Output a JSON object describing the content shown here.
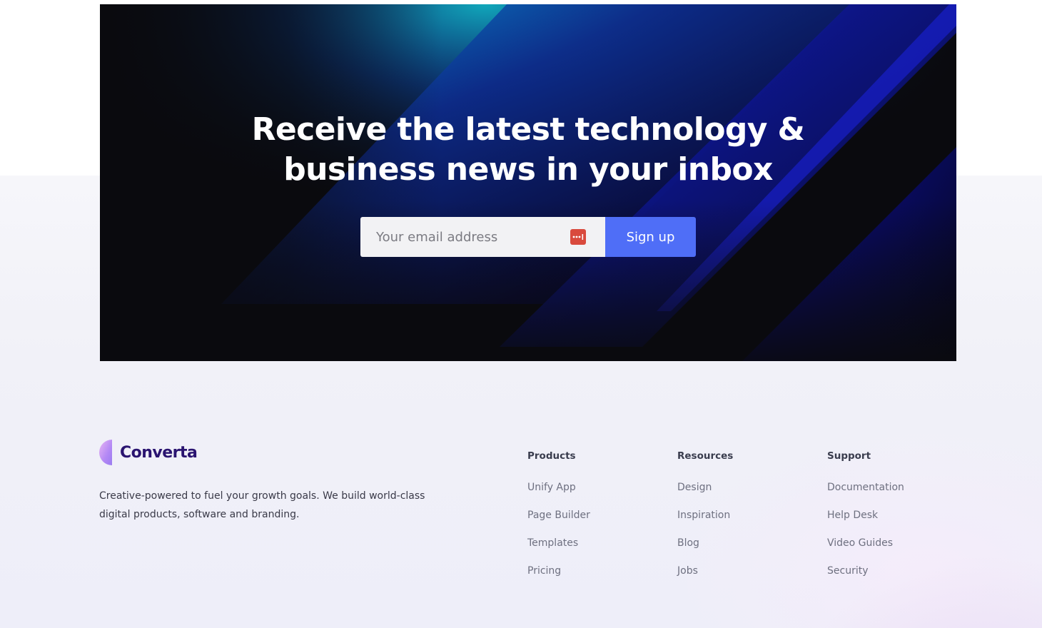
{
  "cta": {
    "title_line1": "Receive the latest technology &",
    "title_line2": "business news in your inbox",
    "email_placeholder": "Your email address",
    "signup_label": "Sign up",
    "password_manager_icon": "password-manager-icon"
  },
  "footer": {
    "brand_name": "Converta",
    "description": "Creative-powered to fuel your growth goals. We build world-class digital products, software and branding.",
    "columns": [
      {
        "title": "Products",
        "links": [
          "Unify App",
          "Page Builder",
          "Templates",
          "Pricing"
        ]
      },
      {
        "title": "Resources",
        "links": [
          "Design",
          "Inspiration",
          "Blog",
          "Jobs"
        ]
      },
      {
        "title": "Support",
        "links": [
          "Documentation",
          "Help Desk",
          "Video Guides",
          "Security"
        ]
      }
    ]
  },
  "colors": {
    "accent": "#4f6ef7",
    "brand": "#2a1470",
    "cta_background": "#0a0a0e"
  }
}
